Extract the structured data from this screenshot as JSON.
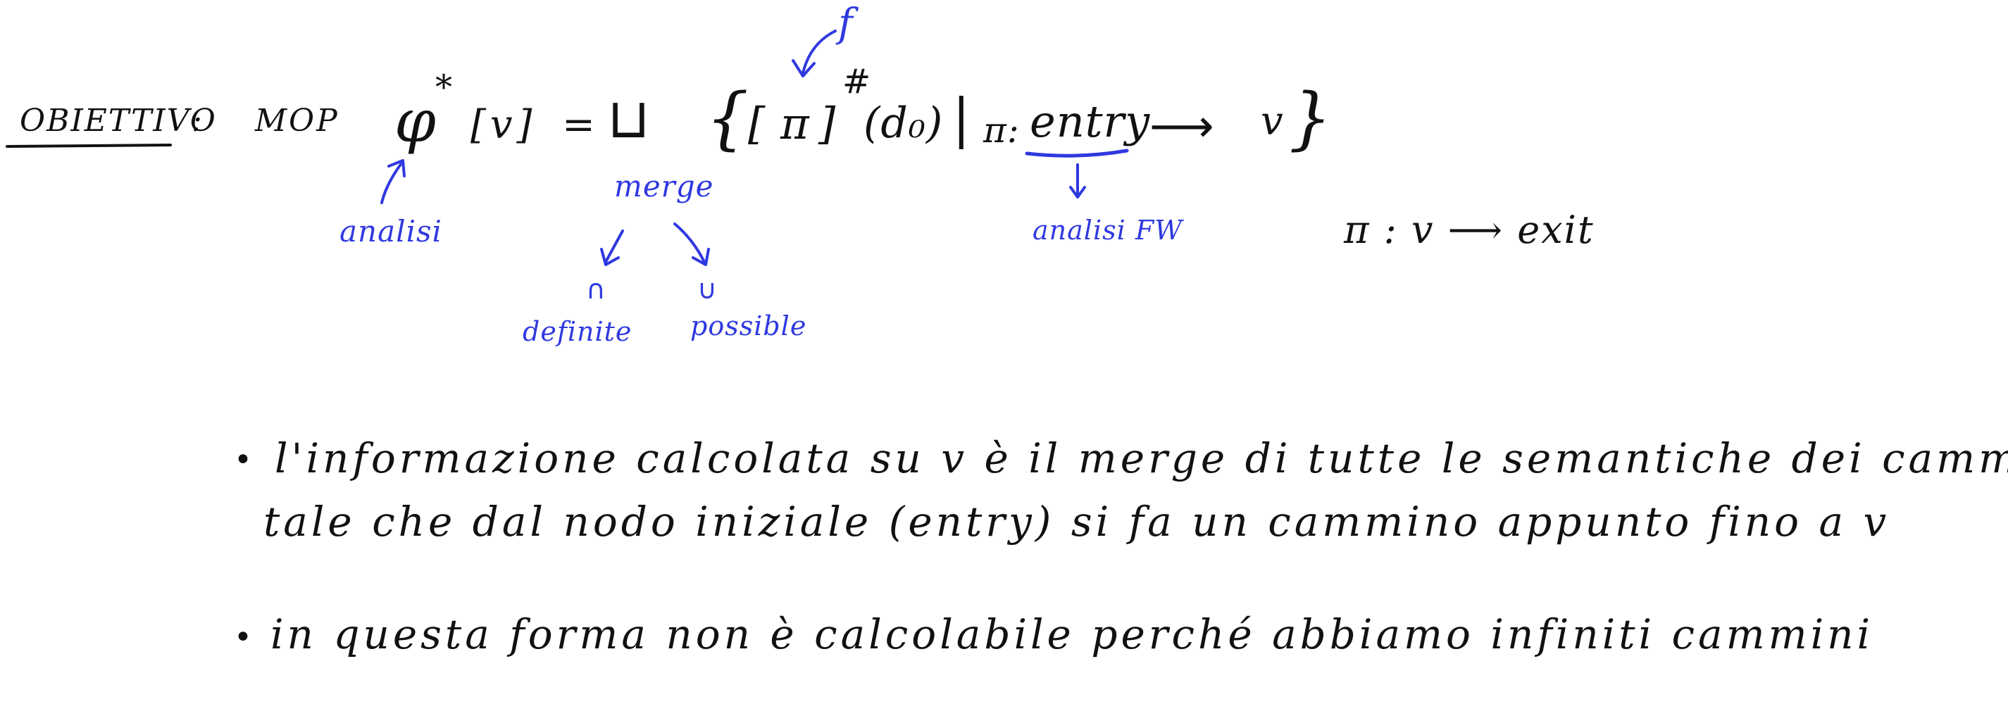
{
  "colors": {
    "ink": "#111111",
    "annotation": "#2f39e0",
    "background": "#ffffff"
  },
  "heading": {
    "label": "OBIETTIVO",
    "colon": ":",
    "mop": "MOP"
  },
  "formula": {
    "phi": "φ",
    "star": "*",
    "arg": "[v]",
    "equals": "=",
    "merge_symbol": "⊔",
    "open_brace": "{",
    "semantics_open": "[",
    "pi": "π",
    "semantics_close": "]",
    "sharp": "#",
    "arg_d0": "(d₀)",
    "bar": "|",
    "path_pi": "π:",
    "entry": "entry",
    "arrow": "⟶",
    "target": "v",
    "close_brace": "}"
  },
  "annotations": {
    "f_label": "f",
    "analisi_label": "analisi",
    "merge_label": "merge",
    "intersection_symbol": "∩",
    "union_symbol": "∪",
    "definite_label": "definite",
    "possible_label": "possible",
    "analisi_fw_label": "analisi FW"
  },
  "backward_path": {
    "text": "π : v ⟶ exit"
  },
  "bullets": [
    {
      "marker": "•",
      "line1": "l'informazione calcolata su v è il merge di tutte le semantiche dei cammini",
      "line2": "tale che dal nodo iniziale (entry) si fa un cammino appunto fino a v"
    },
    {
      "marker": "•",
      "line1": "in questa forma non è calcolabile perché abbiamo infiniti cammini"
    }
  ]
}
